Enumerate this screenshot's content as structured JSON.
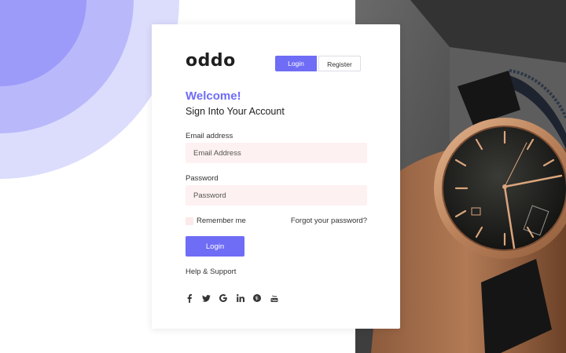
{
  "brand": {
    "logo_text": "oddo"
  },
  "auth_tabs": {
    "login_label": "Login",
    "register_label": "Register"
  },
  "heading": {
    "welcome": "Welcome!",
    "subtitle": "Sign Into Your Account"
  },
  "form": {
    "email": {
      "label": "Email address",
      "placeholder": "Email Address",
      "value": ""
    },
    "password": {
      "label": "Password",
      "placeholder": "Password",
      "value": ""
    },
    "remember_label": "Remember me",
    "remember_checked": false,
    "forgot_label": "Forgot your password?",
    "submit_label": "Login"
  },
  "help_label": "Help & Support",
  "social_icons": [
    "facebook-icon",
    "twitter-icon",
    "google-icon",
    "linkedin-icon",
    "pinterest-icon",
    "youtube-icon"
  ],
  "colors": {
    "accent": "#6f6cf6",
    "input_bg": "#fef1f1",
    "deco_dark": "#9c9bf9",
    "deco_mid": "#b9b8fb",
    "deco_light": "#dcdcfd"
  }
}
